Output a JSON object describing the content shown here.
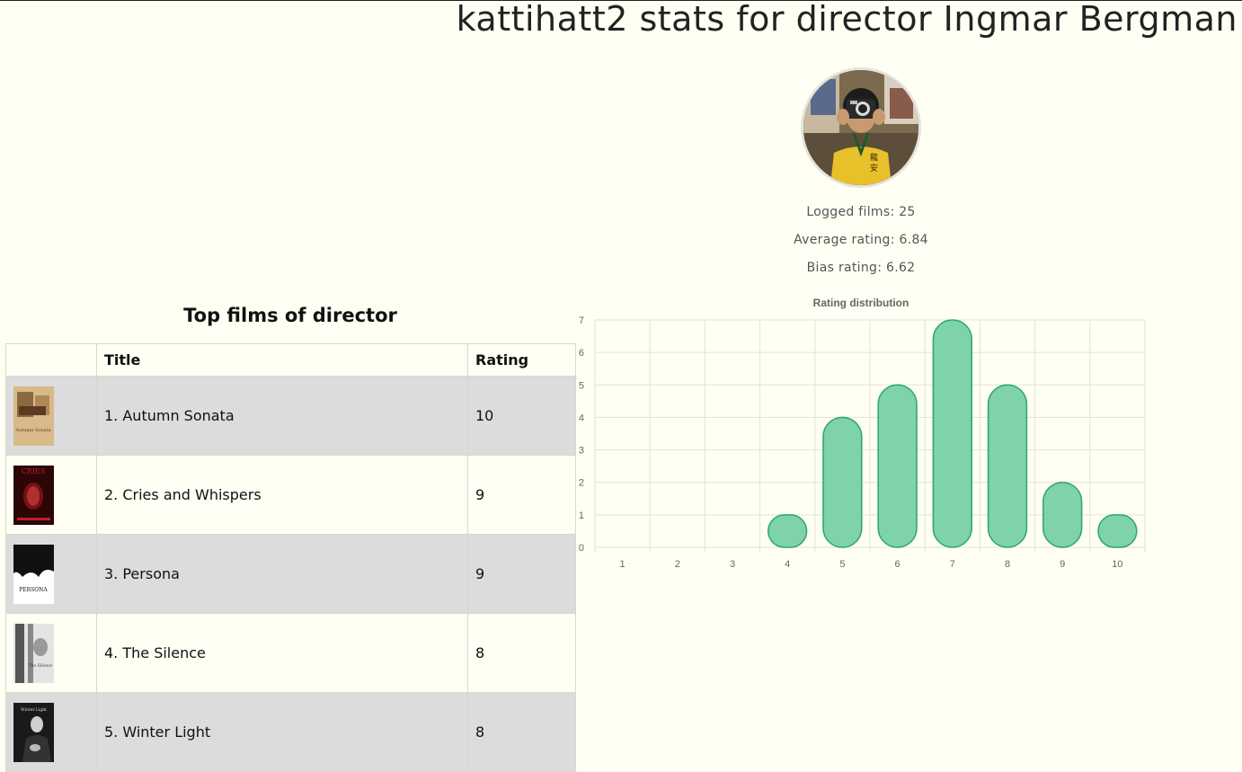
{
  "header": {
    "title": "kattihatt2 stats for director Ingmar Bergman"
  },
  "profile": {
    "avatar_alt": "user avatar",
    "logged_films": "Logged films: 25",
    "average_rating": "Average rating: 6.84",
    "bias_rating": "Bias rating: 6.62"
  },
  "top_films": {
    "heading": "Top films of director",
    "columns": [
      "",
      "Title",
      "Rating"
    ],
    "rows": [
      {
        "title": "1. Autumn Sonata",
        "rating": "10",
        "poster_text": "Autumn Sonata"
      },
      {
        "title": "2. Cries and Whispers",
        "rating": "9",
        "poster_text": "CRIES"
      },
      {
        "title": "3. Persona",
        "rating": "9",
        "poster_text": "PERSONA"
      },
      {
        "title": "4. The Silence",
        "rating": "8",
        "poster_text": "The Silence"
      },
      {
        "title": "5. Winter Light",
        "rating": "8",
        "poster_text": "Winter Light"
      }
    ]
  },
  "colors": {
    "bar_fill": "#7fd3a8",
    "bar_stroke": "#2aa76a",
    "grid": "#e2e2da",
    "row_shade": "#dcdcdc",
    "page_bg": "#fffff4"
  },
  "chart_data": {
    "type": "bar",
    "title": "Rating distribution",
    "categories": [
      "1",
      "2",
      "3",
      "4",
      "5",
      "6",
      "7",
      "8",
      "9",
      "10"
    ],
    "values": [
      0,
      0,
      0,
      1,
      4,
      5,
      7,
      5,
      2,
      1
    ],
    "yticks": [
      "0",
      "1",
      "2",
      "3",
      "4",
      "5",
      "6",
      "7"
    ],
    "ylim": [
      0,
      7
    ],
    "xlabel": "",
    "ylabel": "",
    "grid": true,
    "legend": "none"
  }
}
